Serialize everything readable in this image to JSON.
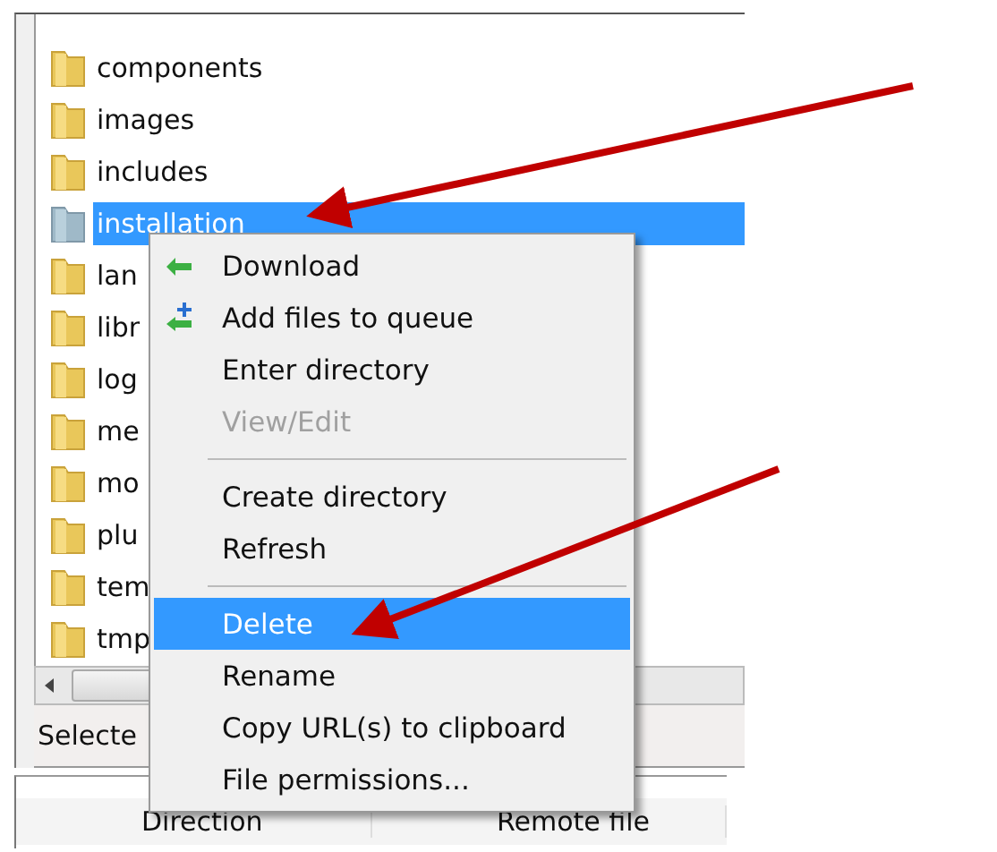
{
  "files": [
    {
      "name": "components",
      "selected": false
    },
    {
      "name": "images",
      "selected": false
    },
    {
      "name": "includes",
      "selected": false
    },
    {
      "name": "installation",
      "selected": true
    },
    {
      "name": "lan",
      "selected": false
    },
    {
      "name": "libr",
      "selected": false
    },
    {
      "name": "log",
      "selected": false
    },
    {
      "name": "me",
      "selected": false
    },
    {
      "name": "mo",
      "selected": false
    },
    {
      "name": "plu",
      "selected": false
    },
    {
      "name": "tem",
      "selected": false
    },
    {
      "name": "tmp",
      "selected": false
    }
  ],
  "status_bar": "Selecte",
  "queue_columns": [
    "Direction",
    "Remote file"
  ],
  "context_menu": [
    {
      "kind": "item",
      "label": "Download",
      "disabled": false,
      "selected": false
    },
    {
      "kind": "item",
      "label": "Add files to queue",
      "disabled": false,
      "selected": false
    },
    {
      "kind": "item",
      "label": "Enter directory",
      "disabled": false,
      "selected": false
    },
    {
      "kind": "item",
      "label": "View/Edit",
      "disabled": true,
      "selected": false
    },
    {
      "kind": "separator"
    },
    {
      "kind": "item",
      "label": "Create directory",
      "disabled": false,
      "selected": false
    },
    {
      "kind": "item",
      "label": "Refresh",
      "disabled": false,
      "selected": false
    },
    {
      "kind": "separator"
    },
    {
      "kind": "item",
      "label": "Delete",
      "disabled": false,
      "selected": true
    },
    {
      "kind": "item",
      "label": "Rename",
      "disabled": false,
      "selected": false
    },
    {
      "kind": "item",
      "label": "Copy URL(s) to clipboard",
      "disabled": false,
      "selected": false
    },
    {
      "kind": "item",
      "label": "File permissions...",
      "disabled": false,
      "selected": false
    }
  ]
}
